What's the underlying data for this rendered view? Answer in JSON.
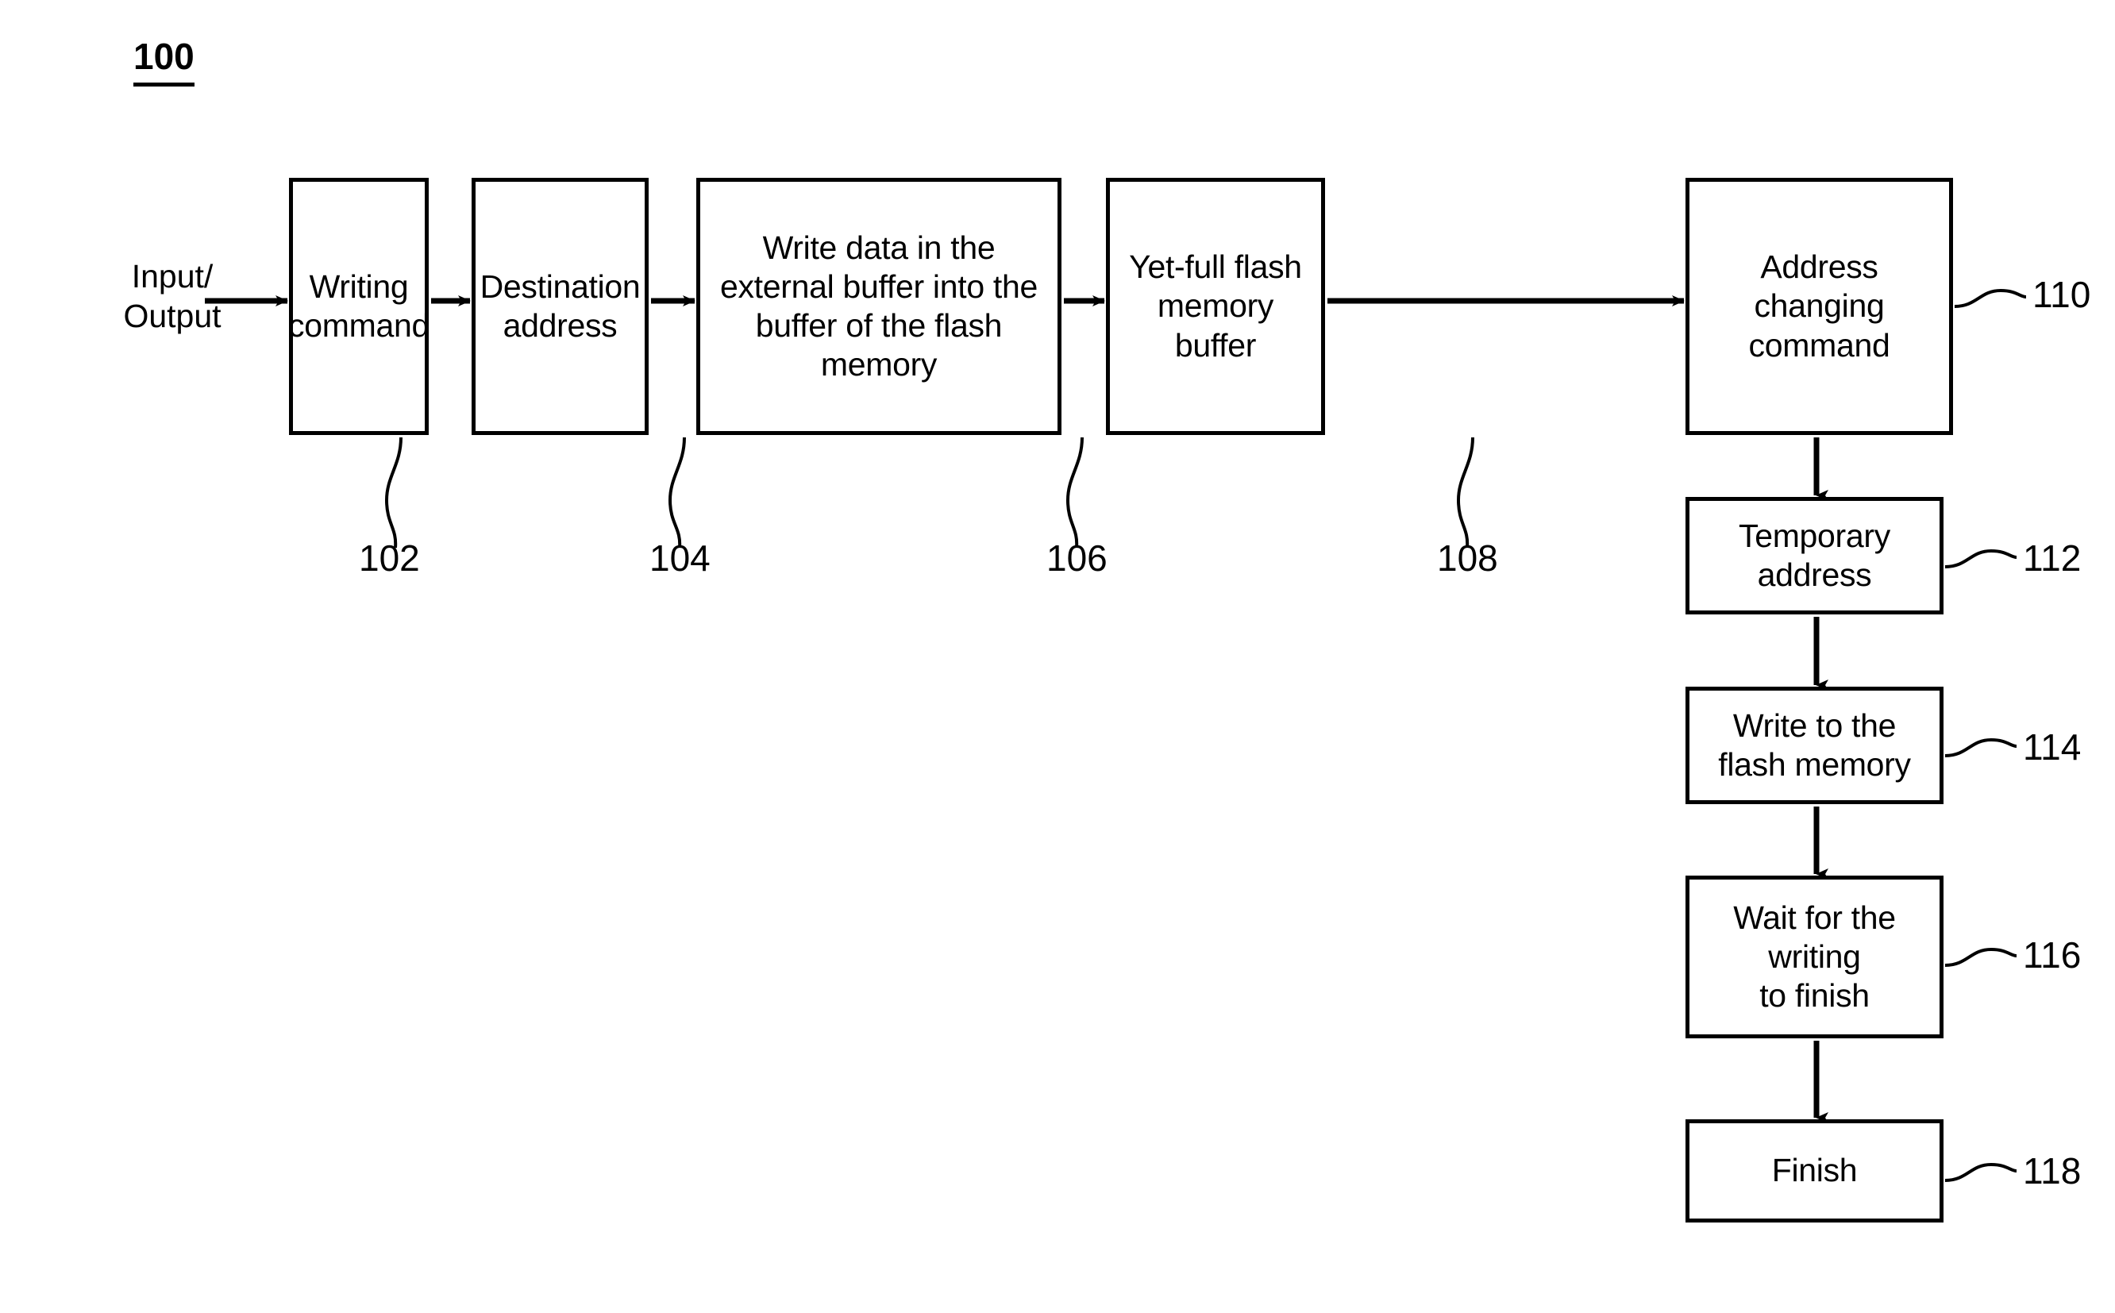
{
  "figure": {
    "number": "100"
  },
  "io": {
    "label": "Input/\nOutput"
  },
  "boxes": [
    {
      "id": "writing-command",
      "label": "Writing\ncommand",
      "ref": "102"
    },
    {
      "id": "destination-address",
      "label": "Destination\naddress",
      "ref": "104"
    },
    {
      "id": "write-data-external-buffer",
      "label": "Write data in the\nexternal buffer into the\nbuffer of the flash\nmemory",
      "ref": "106"
    },
    {
      "id": "yet-full-flash-memory-buffer",
      "label": "Yet-full flash\nmemory\nbuffer",
      "ref": "108"
    },
    {
      "id": "address-changing-command",
      "label": "Address\nchanging\ncommand",
      "ref": "110"
    },
    {
      "id": "temporary-address",
      "label": "Temporary\naddress",
      "ref": "112"
    },
    {
      "id": "write-to-flash-memory",
      "label": "Write to the\nflash memory",
      "ref": "114"
    },
    {
      "id": "wait-for-writing-to-finish",
      "label": "Wait for the\nwriting\nto finish",
      "ref": "116"
    },
    {
      "id": "finish",
      "label": "Finish",
      "ref": "118"
    }
  ],
  "colors": {
    "ink": "#000000",
    "paper": "#ffffff"
  }
}
